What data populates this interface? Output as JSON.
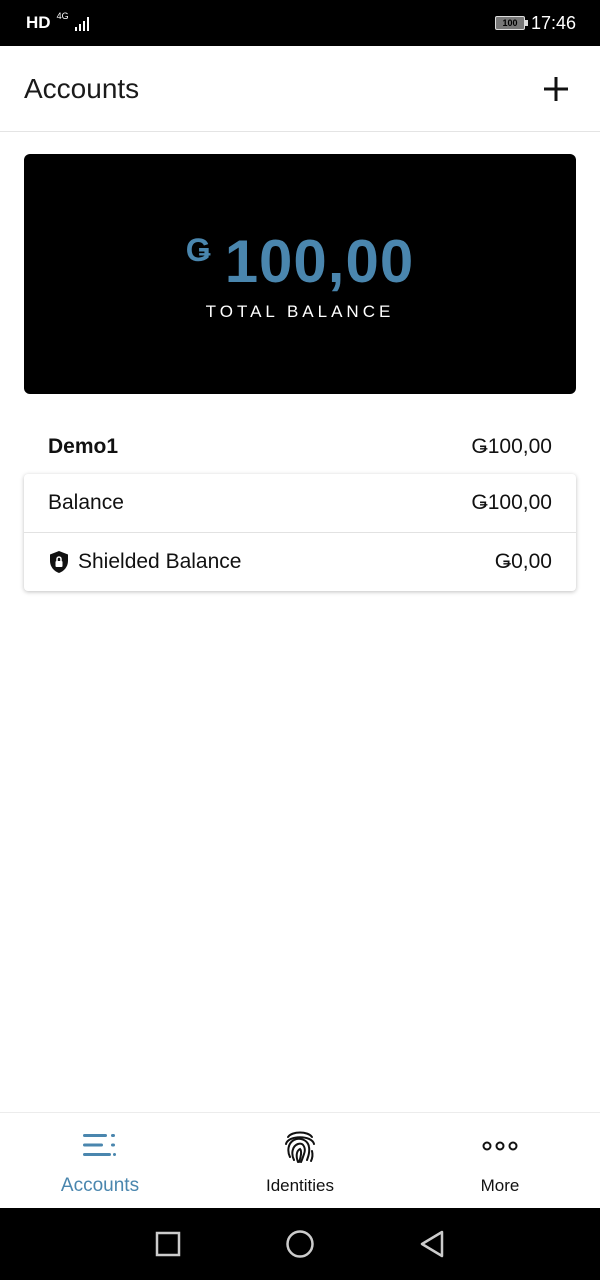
{
  "status_bar": {
    "hd": "HD",
    "network": "4G",
    "battery": "100",
    "time": "17:46"
  },
  "app_bar": {
    "title": "Accounts",
    "add_icon": "plus-icon"
  },
  "balance_card": {
    "currency_symbol": "Ǥ",
    "amount": "100,00",
    "label": "TOTAL BALANCE",
    "accent_color": "#4a86ae"
  },
  "account": {
    "name": "Demo1",
    "total": "Ǥ100,00",
    "rows": [
      {
        "label": "Balance",
        "value": "Ǥ100,00"
      },
      {
        "label": "Shielded Balance",
        "value": "Ǥ0,00",
        "icon": "shield-lock-icon"
      }
    ]
  },
  "bottom_nav": {
    "items": [
      {
        "label": "Accounts",
        "icon": "list-icon",
        "active": true
      },
      {
        "label": "Identities",
        "icon": "fingerprint-icon",
        "active": false
      },
      {
        "label": "More",
        "icon": "more-dots-icon",
        "active": false
      }
    ]
  },
  "system_nav": {
    "icons": [
      "recent-apps-icon",
      "home-icon",
      "back-icon"
    ]
  }
}
